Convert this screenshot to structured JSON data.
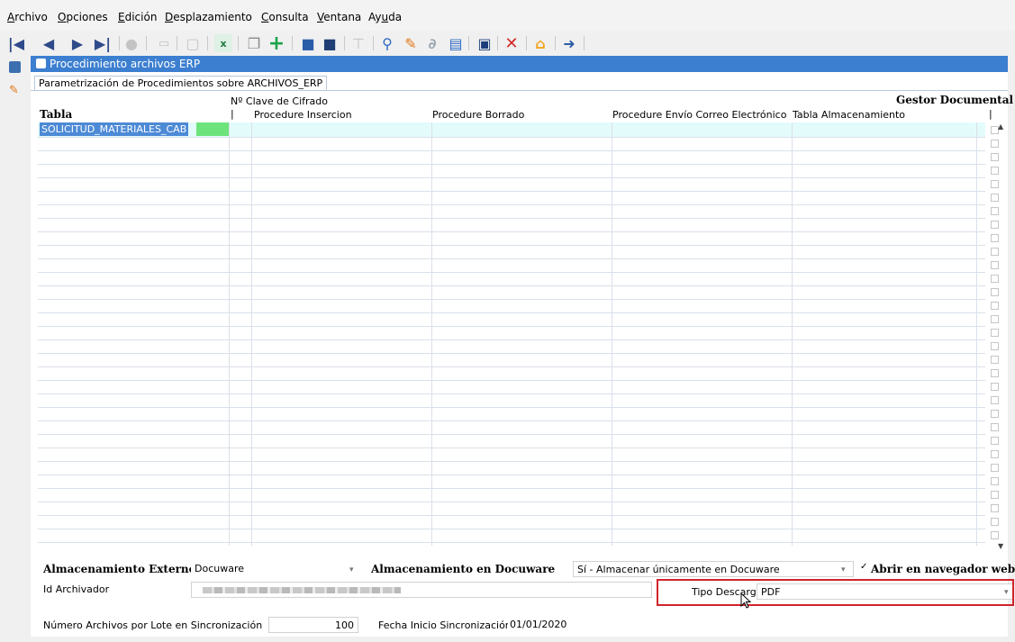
{
  "menu": {
    "items": [
      "Archivo",
      "Opciones",
      "Edición",
      "Desplazamiento",
      "Consulta",
      "Ventana",
      "Ayuda"
    ]
  },
  "toolbar": {
    "icons": [
      "first-record-icon",
      "previous-record-icon",
      "next-record-icon",
      "last-record-icon",
      "disabled-icon",
      "print-icon",
      "blank-icon",
      "excel-export-icon",
      "copy-icon",
      "add-record-icon",
      "database-icon",
      "database-dark-icon",
      "filter-icon",
      "search-icon",
      "edit-icon",
      "attach-icon",
      "document-icon",
      "save-icon",
      "delete-icon",
      "home-icon",
      "exit-icon"
    ]
  },
  "window": {
    "title": "Procedimiento archivos ERP",
    "tab": "Parametrización de Procedimientos sobre ARCHIVOS_ERP"
  },
  "table": {
    "group_header": "Gestor Documental",
    "col_tabla": "Tabla",
    "col_clave": "Nº Clave de Cifrado",
    "col_insercion": "Procedure Insercion",
    "col_borrado": "Procedure Borrado",
    "col_correo": "Procedure Envío Correo Electrónico",
    "col_almacenamiento": "Tabla Almacenamiento",
    "col_end": "|",
    "col_sep": "|",
    "rows": [
      {
        "tabla": "SOLICITUD_MATERIALES_CAB"
      }
    ],
    "row_count": 31
  },
  "form": {
    "almacenamiento_externo_label": "Almacenamiento Externo",
    "almacenamiento_externo_value": "Docuware",
    "almacenamiento_docuware_label": "Almacenamiento en Docuware",
    "almacenamiento_docuware_value": "Sí - Almacenar únicamente en Docuware",
    "abrir_navegador_label": "Abrir en navegador web",
    "abrir_navegador_checked": true,
    "id_archivador_label": "Id Archivador",
    "tipo_descarga_label": "Tipo Descarga",
    "tipo_descarga_value": "PDF",
    "numero_archivos_label": "Número Archivos por Lote en Sincronización",
    "numero_archivos_value": "100",
    "fecha_inicio_label": "Fecha Inicio Sincronización",
    "fecha_inicio_value": "01/01/2020"
  },
  "colors": {
    "title_bar": "#3c7fd0",
    "highlight_box": "#d2232a",
    "selected_cell": "#4d8ad6",
    "row_highlight": "#e4fbfb"
  }
}
